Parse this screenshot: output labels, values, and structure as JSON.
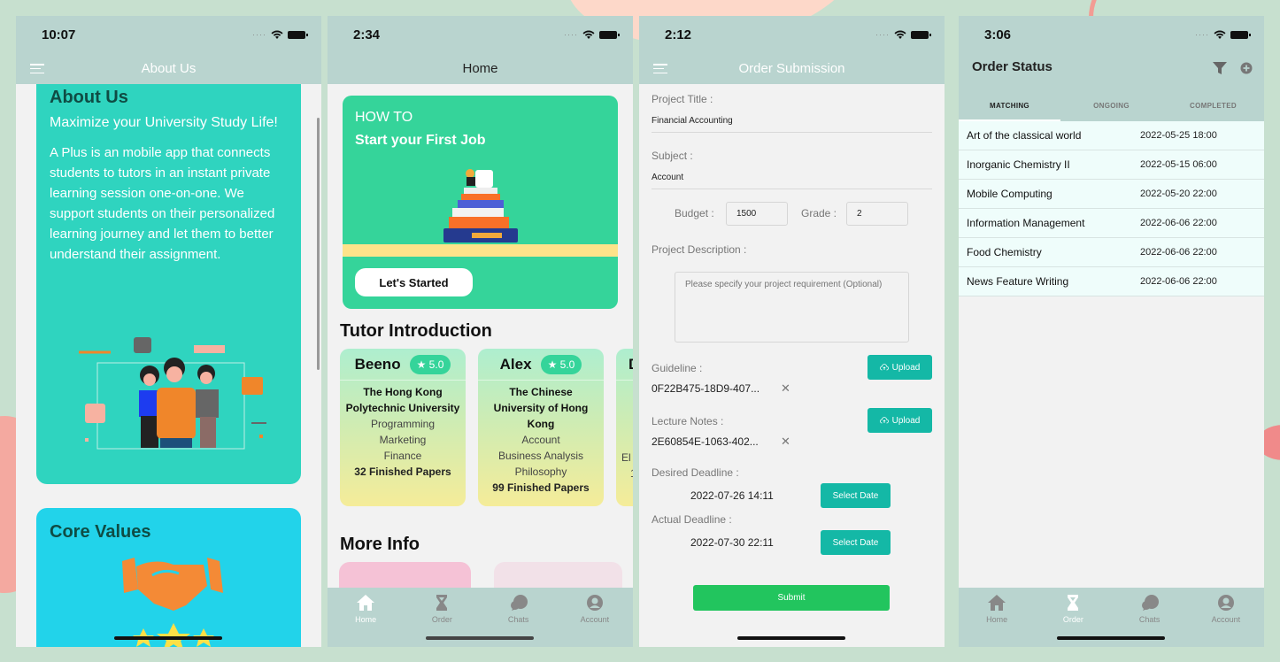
{
  "screens": {
    "about": {
      "status_time": "10:07",
      "nav_title": "About Us",
      "card_title": "About Us",
      "subtitle": "Maximize your University Study Life!",
      "body": "A Plus is an mobile app that connects students to tutors in an instant private learning session one-on-one. We support students on their personalized learning journey and let them to better understand their assignment.",
      "core_title": "Core Values",
      "colors": {
        "about_card": "#2fd4bf",
        "core_card": "#22d3ea"
      }
    },
    "home": {
      "status_time": "2:34",
      "nav_title": "Home",
      "banner": {
        "label": "HOW TO",
        "title": "Start your First Job",
        "button": "Let's Started"
      },
      "tutor_section_title": "Tutor Introduction",
      "tutors": [
        {
          "name": "Beeno",
          "rating": "★ 5.0",
          "university": "The Hong Kong Polytechnic University",
          "subjects": [
            "Programming",
            "Marketing",
            "Finance"
          ],
          "papers": "32 Finished Papers"
        },
        {
          "name": "Alex",
          "rating": "★ 5.0",
          "university": "The Chinese University of Hong Kong",
          "subjects": [
            "Account",
            "Business Analysis",
            "Philosophy"
          ],
          "papers": "99 Finished Papers"
        },
        {
          "name": "D",
          "subjects_partial": "El",
          "papers_partial": "1"
        }
      ],
      "more_info_title": "More Info"
    },
    "order_submission": {
      "status_time": "2:12",
      "nav_title": "Order Submission",
      "project_title_label": "Project Title :",
      "project_title_value": "Financial Accounting",
      "subject_label": "Subject :",
      "subject_value": "Account",
      "budget_label": "Budget :",
      "budget_value": "1500",
      "grade_label": "Grade :",
      "grade_value": "2",
      "description_label": "Project Description :",
      "description_placeholder": "Please specify your project requirement (Optional)",
      "guideline_label": "Guideline :",
      "guideline_file": "0F22B475-18D9-407...",
      "lecture_label": "Lecture Notes :",
      "lecture_file": "2E60854E-1063-402...",
      "upload_label": "Upload",
      "remove_glyph": "✕",
      "desired_label": "Desired Deadline :",
      "desired_value": "2022-07-26 14:11",
      "actual_label": "Actual Deadline :",
      "actual_value": "2022-07-30 22:11",
      "select_date_label": "Select Date",
      "submit_label": "Submit"
    },
    "order_status": {
      "status_time": "3:06",
      "title": "Order Status",
      "tabs": [
        "MATCHING",
        "ONGOING",
        "COMPLETED"
      ],
      "active_tab": "MATCHING",
      "orders": [
        {
          "name": "Art of the classical world",
          "date": "2022-05-25 18:00"
        },
        {
          "name": "Inorganic Chemistry II",
          "date": "2022-05-15 06:00"
        },
        {
          "name": "Mobile Computing",
          "date": "2022-05-20 22:00"
        },
        {
          "name": "Information Management",
          "date": "2022-06-06 22:00"
        },
        {
          "name": "Food Chemistry",
          "date": "2022-06-06 22:00"
        },
        {
          "name": "News Feature Writing",
          "date": "2022-06-06 22:00"
        }
      ]
    }
  },
  "tabbar": {
    "items": [
      "Home",
      "Order",
      "Chats",
      "Account"
    ]
  },
  "theme": {
    "header_bg": "#b9d4cf",
    "accent_green": "#35d49a",
    "teal_button": "#14b8a6",
    "submit_green": "#22c55e"
  }
}
